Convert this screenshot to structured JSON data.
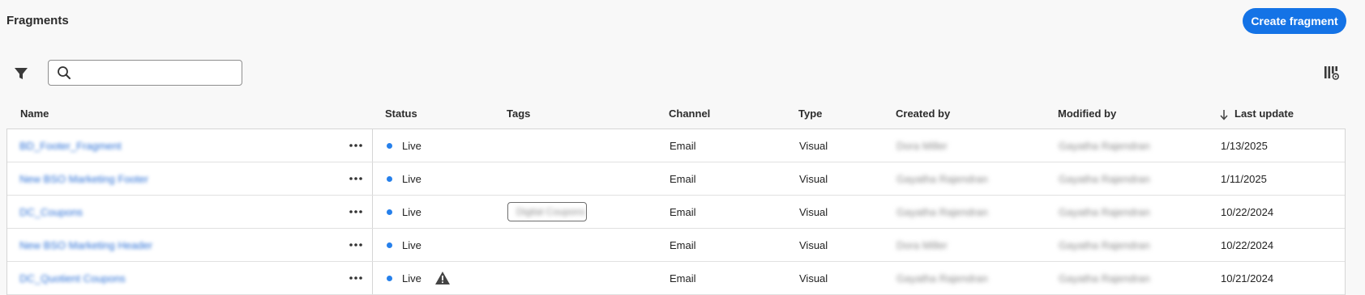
{
  "header": {
    "title": "Fragments",
    "create_button": "Create fragment"
  },
  "toolbar": {
    "search_placeholder": "",
    "search_value": ""
  },
  "columns": {
    "name": "Name",
    "status": "Status",
    "tags": "Tags",
    "channel": "Channel",
    "type": "Type",
    "created_by": "Created by",
    "modified_by": "Modified by",
    "last_update": "Last update"
  },
  "sort": {
    "column": "Last update",
    "direction": "descending"
  },
  "rows": [
    {
      "name": "BD_Footer_Fragment",
      "status": "Live",
      "warning": false,
      "tag": "",
      "channel": "Email",
      "type": "Visual",
      "created_by": "Dora Miller",
      "modified_by": "Gayatha Rajendran",
      "last_update": "1/13/2025"
    },
    {
      "name": "New BSO Marketing Footer",
      "status": "Live",
      "warning": false,
      "tag": "",
      "channel": "Email",
      "type": "Visual",
      "created_by": "Gayatha Rajendran",
      "modified_by": "Gayatha Rajendran",
      "last_update": "1/11/2025"
    },
    {
      "name": "DC_Coupons",
      "status": "Live",
      "warning": false,
      "tag": "Digital Coupons",
      "channel": "Email",
      "type": "Visual",
      "created_by": "Gayatha Rajendran",
      "modified_by": "Gayatha Rajendran",
      "last_update": "10/22/2024"
    },
    {
      "name": "New BSO Marketing Header",
      "status": "Live",
      "warning": false,
      "tag": "",
      "channel": "Email",
      "type": "Visual",
      "created_by": "Dora Miller",
      "modified_by": "Gayatha Rajendran",
      "last_update": "10/22/2024"
    },
    {
      "name": "DC_Quotient Coupons",
      "status": "Live",
      "warning": true,
      "tag": "",
      "channel": "Email",
      "type": "Visual",
      "created_by": "Gayatha Rajendran",
      "modified_by": "Gayatha Rajendran",
      "last_update": "10/21/2024"
    }
  ],
  "colors": {
    "accent": "#1473e6",
    "status_live": "#2680eb",
    "background": "#f8f8f8"
  },
  "icons": {
    "filter": "filter-icon",
    "search": "search-icon",
    "column_settings": "column-settings-icon",
    "sort": "arrow-down-icon",
    "more": "more-horizontal-icon",
    "warning": "warning-icon"
  }
}
